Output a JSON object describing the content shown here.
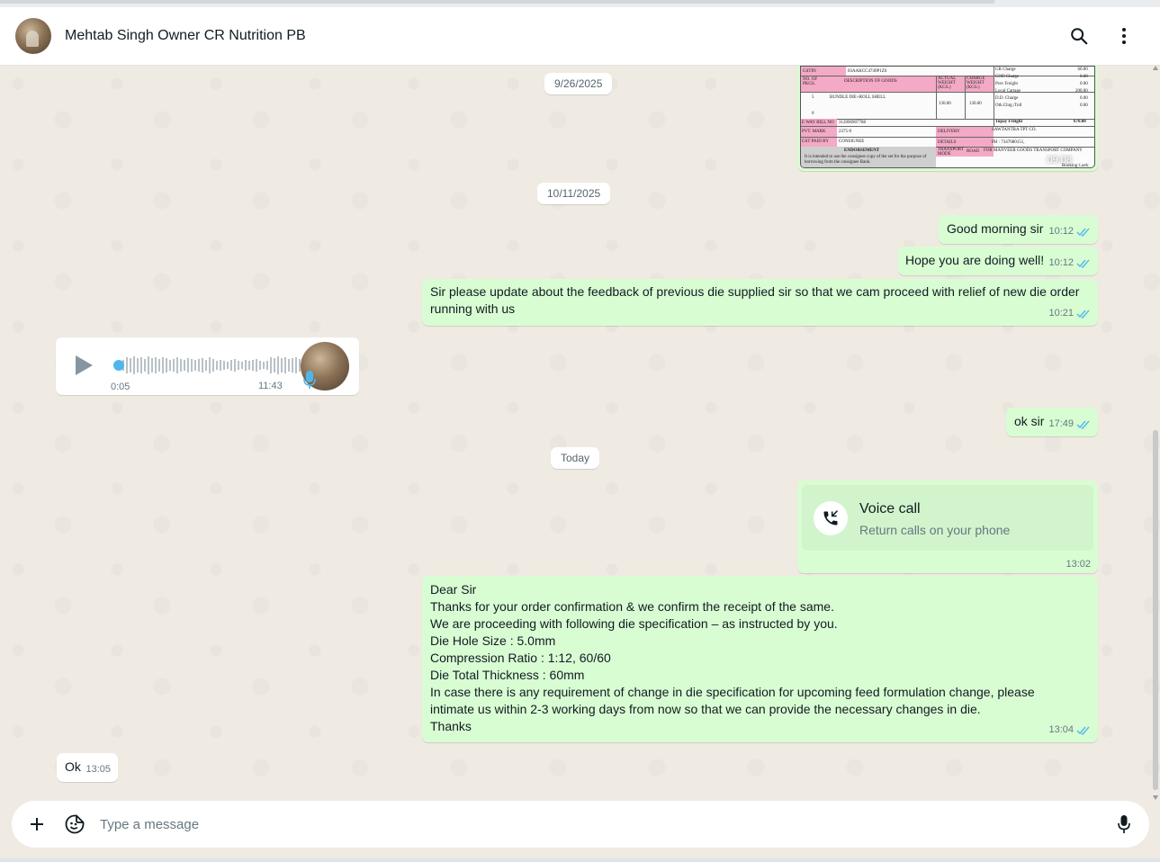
{
  "header": {
    "contact_name": "Mehtab Singh Owner CR Nutrition PB"
  },
  "dates": {
    "d1": "9/26/2025",
    "d2": "10/11/2025",
    "d3": "Today"
  },
  "invoice_image": {
    "time": "09:08",
    "labels": {
      "gstin": "GSTIN",
      "gstin_value": "03AAKCC4749P1Z6",
      "no_pkgs": "NO. OF PKGS.",
      "description": "DESCRIPTION OF GOODS",
      "actual_weight": "ACTUAL WEIGHT (KGS.)",
      "charge_weight": "CHARGE WEIGHT (KGS.)",
      "pkgs_value": "5",
      "goods_value": "BUNDLE DIE+ROLL SHELL",
      "actual_value": "130.00",
      "charge_value": "130.00",
      "pkgs_value_2": "0",
      "eway": "E WAY BILL NO",
      "eway_value": "312090907788",
      "pvt_mark": "PVT. MARK",
      "pvt_value": "2375-9",
      "gst_paid": "GST PAID BY",
      "gst_paid_value": "CONSIGNEE",
      "delivery": "DELIVERY",
      "delivery_value": "SAWTANTRA TPT CO.",
      "details": "DETAILS",
      "ph": "PH : 7347080151,",
      "transport_mode": "TRANSPORT MODE",
      "road": "ROAD",
      "for_company": "FOR MANVEER GOODS TRANSPORT COMPANY",
      "booking_clerk": "Booking Clerk",
      "endorsement": "ENDORSEMENT",
      "endorsement_text": "It is intended to use the consignee copy of the set for the purpose of borrowing from the consignee Bank.",
      "charges": [
        "GR Charge",
        "COD Charge",
        "Prev Freight",
        "Local Cartage",
        "D.D. Charge",
        "Oth.Chrg./Toll"
      ],
      "charge_values": [
        "60.00",
        "0.00",
        "0.00",
        "200.00",
        "0.00",
        "0.00"
      ],
      "topay": "Topay Freight",
      "topay_value": "670.00"
    }
  },
  "messages": [
    {
      "text": "Good morning sir",
      "time": "10:12"
    },
    {
      "text": "Hope you are doing well!",
      "time": "10:12"
    },
    {
      "text": "Sir please update about the feedback of previous die supplied sir so that we cam proceed with relief of new die order running with us",
      "time": "10:21"
    },
    {
      "text": "ok sir",
      "time": "17:49"
    },
    {
      "text": "Dear Sir\nThanks for your order confirmation & we confirm the receipt of the same.\nWe are proceeding with following die specification – as instructed by you.\nDie Hole Size : 5.0mm\nCompression Ratio : 1:12, 60/60\nDie Total Thickness : 60mm\nIn case there is any requirement of change in die specification for upcoming feed formulation change, please\nintimate us within 2-3 working days from now so that we can provide the necessary changes in die.\nThanks",
      "time": "13:04"
    },
    {
      "text": "Ok",
      "time": "13:05"
    }
  ],
  "voice_note": {
    "duration": "0:05",
    "time": "11:43"
  },
  "voice_call": {
    "title": "Voice call",
    "subtitle": "Return calls on your phone",
    "time": "13:02"
  },
  "composer": {
    "placeholder": "Type a message"
  },
  "colors": {
    "outgoing_bubble": "#d9fdd3",
    "incoming_bubble": "#ffffff",
    "read_ticks": "#53bdeb",
    "chat_background": "#efeae2"
  },
  "icons": {
    "search": "search-icon",
    "menu": "more-vertical-icon",
    "attach": "plus-icon",
    "sticker": "sticker-icon",
    "mic": "mic-icon",
    "phone": "missed-call-icon"
  }
}
